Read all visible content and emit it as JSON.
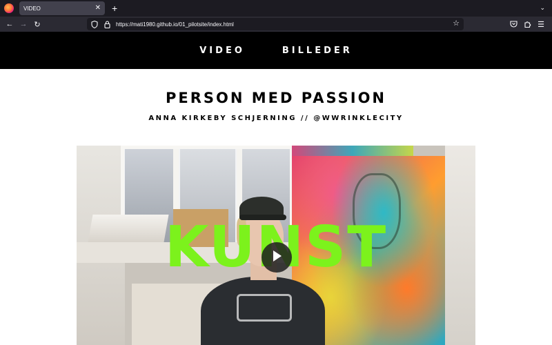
{
  "browser": {
    "tab": {
      "title": "VIDEO"
    },
    "url": "https://mati1980.github.io/01_pilotsite/index.html",
    "colors": {
      "toolbar": "#2b2a33",
      "tabbar": "#1c1b22",
      "tab_active": "#42414d"
    }
  },
  "site": {
    "nav": {
      "items": [
        "VIDEO",
        "BILLEDER"
      ]
    },
    "title": "PERSON MED PASSION",
    "subtitle": "ANNA KIRKEBY SCHJERNING // @WWRINKLECITY",
    "video": {
      "overlay_text": "KUNST",
      "overlay_color": "#7cf21c"
    },
    "colors": {
      "nav_bg": "#000000",
      "page_bg": "#ffffff"
    }
  },
  "icons": [
    "firefox-logo-icon",
    "close-icon",
    "plus-icon",
    "back-arrow-icon",
    "forward-arrow-icon",
    "reload-icon",
    "shield-icon",
    "lock-icon",
    "star-icon",
    "pocket-icon",
    "extensions-icon",
    "menu-icon",
    "play-icon",
    "chevron-down-icon"
  ]
}
